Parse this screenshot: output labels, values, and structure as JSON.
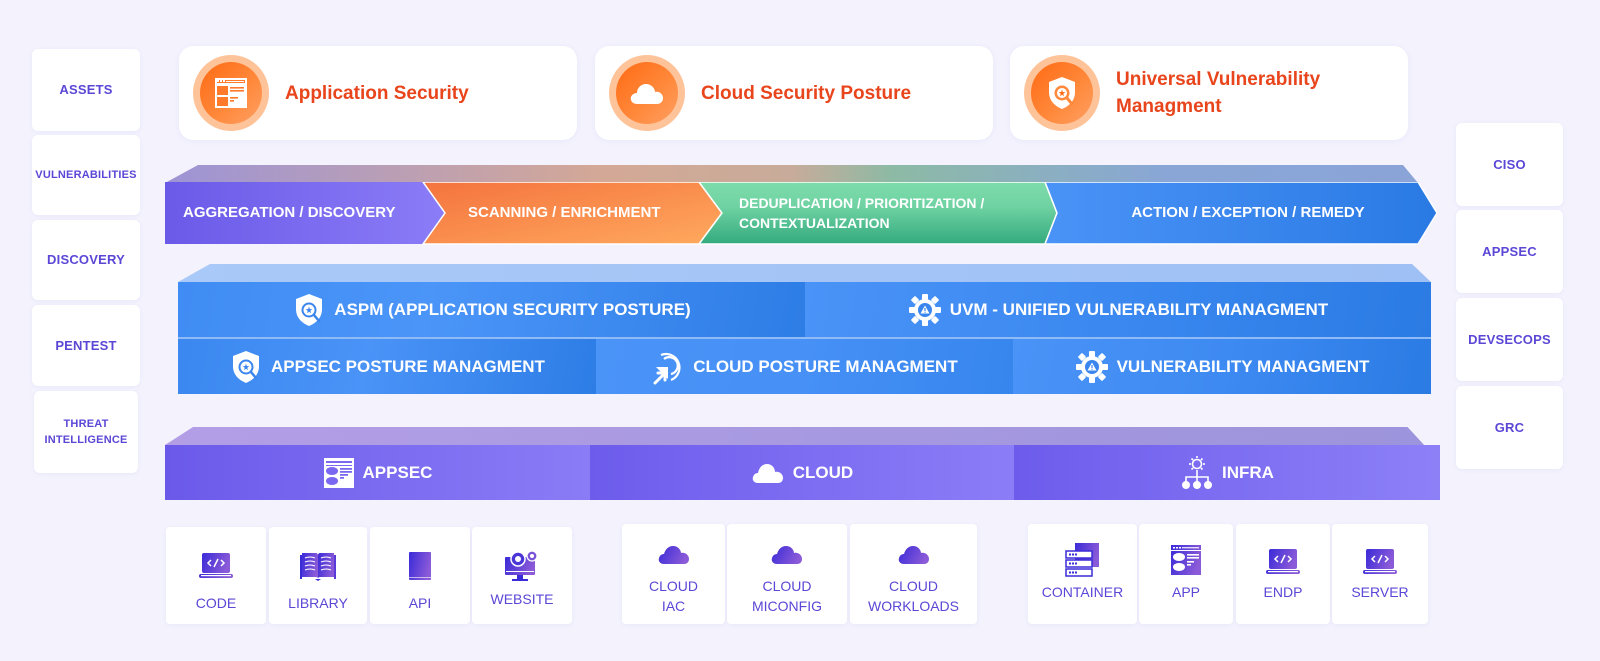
{
  "left_sidebar": {
    "items": [
      {
        "label": "ASSETS"
      },
      {
        "label": "VULNERABILITIES"
      },
      {
        "label": "DISCOVERY"
      },
      {
        "label": "PENTEST"
      },
      {
        "label": "THREAT INTELLIGENCE",
        "line1": "THREAT",
        "line2": "INTELLIGENCE"
      }
    ]
  },
  "right_sidebar": {
    "items": [
      {
        "label": "CISO"
      },
      {
        "label": "APPSEC"
      },
      {
        "label": "DEVSECOPS"
      },
      {
        "label": "GRC"
      }
    ]
  },
  "top_cards": [
    {
      "title": "Application Security",
      "icon": "browser-window-icon"
    },
    {
      "title": "Cloud Security Posture",
      "icon": "cloud-icon"
    },
    {
      "title": "Universal Vulnerability Managment",
      "line1": "Universal Vulnerability",
      "line2": "Managment",
      "icon": "shield-search-icon"
    }
  ],
  "pipeline": {
    "stages": [
      {
        "label": "AGGREGATION / DISCOVERY",
        "color_start": "#6a5ae8",
        "color_end": "#8b7cf7"
      },
      {
        "label": "SCANNING / ENRICHMENT",
        "color_start": "#f4733e",
        "color_end": "#ffa25e"
      },
      {
        "label": "DEDUPLICATION / PRIORITIZATION / CONTEXTUALIZATION",
        "line1": "DEDUPLICATION / PRIORITIZATION /",
        "line2": "CONTEXTUALIZATION",
        "color_start": "#7edaa9",
        "color_end": "#35ad80"
      },
      {
        "label": "ACTION / EXCEPTION / REMEDY",
        "color_start": "#4791f6",
        "color_end": "#2a7be4"
      }
    ]
  },
  "platform": {
    "row1": [
      {
        "label": "ASPM (APPLICATION SECURITY POSTURE)",
        "icon": "shield-search-icon"
      },
      {
        "label": "UVM - UNIFIED VULNERABILITY MANAGMENT",
        "icon": "gear-warning-icon"
      }
    ],
    "row2": [
      {
        "label": "APPSEC POSTURE MANAGMENT",
        "icon": "shield-search-icon"
      },
      {
        "label": "CLOUD POSTURE MANAGMENT",
        "icon": "cursor-ring-icon"
      },
      {
        "label": "VULNERABILITY MANAGMENT",
        "icon": "gear-warning-icon"
      }
    ]
  },
  "categories": [
    {
      "label": "APPSEC",
      "icon": "browser-window-icon"
    },
    {
      "label": "CLOUD",
      "icon": "cloud-icon"
    },
    {
      "label": "INFRA",
      "icon": "network-gear-icon"
    }
  ],
  "sources": {
    "appsec": [
      {
        "label": "CODE",
        "icon": "laptop-code-icon"
      },
      {
        "label": "LIBRARY",
        "icon": "open-book-icon"
      },
      {
        "label": "API",
        "icon": "book-icon"
      },
      {
        "label": "WEBSITE",
        "icon": "monitor-gears-icon"
      }
    ],
    "cloud": [
      {
        "label": "CLOUD IAC",
        "line1": "CLOUD",
        "line2": "IAC",
        "icon": "cloud-icon"
      },
      {
        "label": "CLOUD MICONFIG",
        "line1": "CLOUD",
        "line2": "MICONFIG",
        "icon": "cloud-icon"
      },
      {
        "label": "CLOUD WORKLOADS",
        "line1": "CLOUD",
        "line2": "WORKLOADS",
        "icon": "cloud-icon"
      }
    ],
    "infra": [
      {
        "label": "CONTAINER",
        "icon": "server-stack-icon"
      },
      {
        "label": "APP",
        "icon": "app-window-icon"
      },
      {
        "label": "ENDP",
        "icon": "laptop-code-icon"
      },
      {
        "label": "SERVER",
        "icon": "laptop-code-icon"
      }
    ]
  },
  "colors": {
    "background": "#f3f2fd",
    "label_purple": "#5b47d6",
    "accent_orange": "#e8451c",
    "blue": "#3a86ee",
    "violet": "#7a68f0"
  }
}
